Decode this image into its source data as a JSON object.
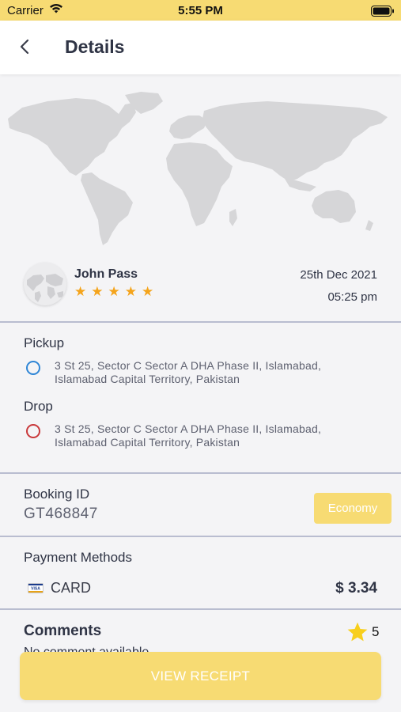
{
  "status_bar": {
    "carrier": "Carrier",
    "time": "5:55 PM"
  },
  "header": {
    "title": "Details"
  },
  "driver": {
    "name": "John Pass",
    "rating_stars": 5
  },
  "trip": {
    "date": "25th Dec 2021",
    "time": "05:25 pm"
  },
  "pickup": {
    "label": "Pickup",
    "address_line1": "3 St 25, Sector C Sector A DHA Phase II, Islamabad,",
    "address_line2": "Islamabad Capital Territory, Pakistan"
  },
  "drop": {
    "label": "Drop",
    "address_line1": "3 St 25, Sector C Sector A DHA Phase II, Islamabad,",
    "address_line2": "Islamabad Capital Territory, Pakistan"
  },
  "booking": {
    "label": "Booking ID",
    "id": "GT468847",
    "ride_type": "Economy"
  },
  "payment": {
    "label": "Payment Methods",
    "card_brand": "VISA",
    "method": "CARD",
    "amount": "$ 3.34"
  },
  "comments": {
    "title": "Comments",
    "rating": "5",
    "text": "No comment available"
  },
  "actions": {
    "view_receipt": "VIEW RECEIPT"
  },
  "colors": {
    "accent": "#f7db73",
    "star": "#f4a41c",
    "rating_star": "#f8cf1c",
    "pickup_dot": "#2f86d6",
    "drop_dot": "#c9393b"
  },
  "icons": {
    "back": "chevron-left-icon",
    "wifi": "wifi-icon",
    "battery": "battery-icon",
    "card": "visa-card-icon",
    "rating": "star-icon"
  }
}
